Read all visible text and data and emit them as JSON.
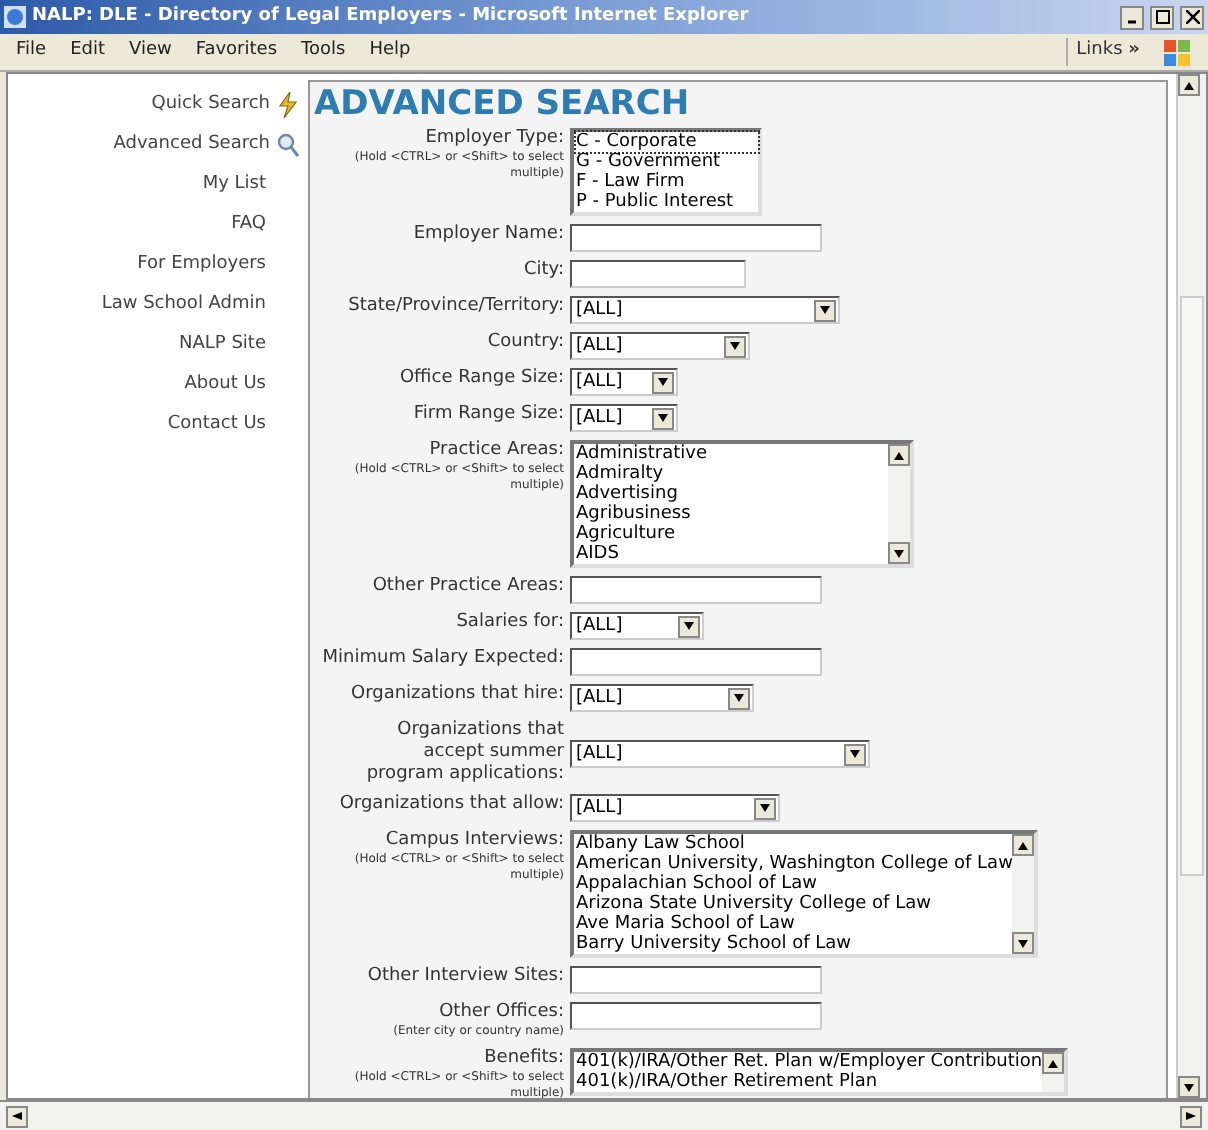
{
  "window": {
    "title": "NALP: DLE - Directory of Legal Employers - Microsoft Internet Explorer"
  },
  "menu": [
    "File",
    "Edit",
    "View",
    "Favorites",
    "Tools",
    "Help"
  ],
  "links": {
    "label": "Links",
    "chevron": "»"
  },
  "sidebar": {
    "items": [
      {
        "label": "Quick Search"
      },
      {
        "label": "Advanced Search"
      },
      {
        "label": "My List"
      },
      {
        "label": "FAQ"
      },
      {
        "label": "For Employers"
      },
      {
        "label": "Law School Admin"
      },
      {
        "label": "NALP Site"
      },
      {
        "label": "About Us"
      },
      {
        "label": "Contact Us"
      }
    ]
  },
  "heading": "ADVANCED SEARCH",
  "fields": [
    {
      "kind": "listbox",
      "label": "Employer Type:",
      "note": "(Hold <CTRL> or <Shift> to select multiple)",
      "options": [
        "C - Corporate",
        "G - Government",
        "F - Law Firm",
        "P - Public Interest"
      ],
      "scroll": false
    },
    {
      "kind": "text",
      "label": "Employer Name:"
    },
    {
      "kind": "text",
      "label": "City:"
    },
    {
      "kind": "select",
      "label": "State/Province/Territory:",
      "value": "[ALL]"
    },
    {
      "kind": "select",
      "label": "Country:",
      "value": "[ALL]"
    },
    {
      "kind": "select",
      "label": "Office Range Size:",
      "value": "[ALL]"
    },
    {
      "kind": "select",
      "label": "Firm Range Size:",
      "value": "[ALL]"
    },
    {
      "kind": "listbox",
      "label": "Practice Areas:",
      "note": "(Hold <CTRL> or <Shift> to select multiple)",
      "options": [
        "Administrative",
        "Admiralty",
        "Advertising",
        "Agribusiness",
        "Agriculture",
        "AIDS"
      ],
      "scroll": true
    },
    {
      "kind": "text",
      "label": "Other Practice Areas:"
    },
    {
      "kind": "select",
      "label": "Salaries for:",
      "value": "[ALL]"
    },
    {
      "kind": "text",
      "label": "Minimum Salary Expected:"
    },
    {
      "kind": "select",
      "label": "Organizations that hire:",
      "value": "[ALL]"
    },
    {
      "kind": "select",
      "label": "Organizations that accept summer program applications:",
      "value": "[ALL]"
    },
    {
      "kind": "select",
      "label": "Organizations that allow:",
      "value": "[ALL]"
    },
    {
      "kind": "listbox",
      "label": "Campus Interviews:",
      "note": "(Hold <CTRL> or <Shift> to select multiple)",
      "options": [
        "Albany Law School",
        "American University, Washington College of Law",
        "Appalachian School of Law",
        "Arizona State University College of Law",
        "Ave Maria School of Law",
        "Barry University School of Law"
      ],
      "scroll": true
    },
    {
      "kind": "text",
      "label": "Other Interview Sites:"
    },
    {
      "kind": "text",
      "label": "Other Offices:",
      "note": "(Enter city or country name)"
    },
    {
      "kind": "listbox",
      "label": "Benefits:",
      "note": "(Hold <CTRL> or <Shift> to select multiple)",
      "options": [
        "401(k)/IRA/Other Ret. Plan w/Employer Contribution",
        "401(k)/IRA/Other Retirement Plan"
      ],
      "scroll": true,
      "cut": true
    }
  ]
}
